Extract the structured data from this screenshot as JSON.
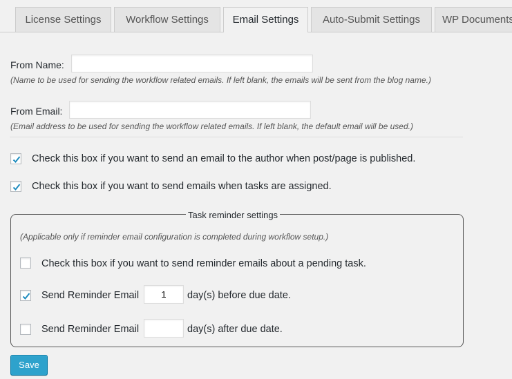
{
  "tabs": [
    {
      "label": "License Settings",
      "active": false
    },
    {
      "label": "Workflow Settings",
      "active": false
    },
    {
      "label": "Email Settings",
      "active": true
    },
    {
      "label": "Auto-Submit Settings",
      "active": false
    },
    {
      "label": "WP Documents",
      "active": false
    }
  ],
  "from_name": {
    "label": "From Name:",
    "value": "",
    "help": "(Name to be used for sending the workflow related emails. If left blank, the emails will be sent from the blog name.)"
  },
  "from_email": {
    "label": "From Email:",
    "value": "",
    "help": "(Email address to be used for sending the workflow related emails. If left blank, the default email will be used.)"
  },
  "options": {
    "publish_email": {
      "label": "Check this box if you want to send an email to the author when post/page is published.",
      "checked": true
    },
    "assign_email": {
      "label": "Check this box if you want to send emails when tasks are assigned.",
      "checked": true
    }
  },
  "reminder": {
    "legend": "Task reminder settings",
    "note": "(Applicable only if reminder email configuration is completed during workflow setup.)",
    "pending_task": {
      "label": "Check this box if you want to send reminder emails about a pending task.",
      "checked": false
    },
    "before_due": {
      "label": "Send Reminder Email",
      "days": "1",
      "suffix": "day(s) before due date.",
      "checked": true
    },
    "after_due": {
      "label": "Send Reminder Email",
      "days": "",
      "suffix": "day(s) after due date.",
      "checked": false
    }
  },
  "save_label": "Save",
  "colors": {
    "background": "#f1f1f1",
    "checkmark": "#1e8cbe",
    "primary_button": "#2ea2cc"
  }
}
